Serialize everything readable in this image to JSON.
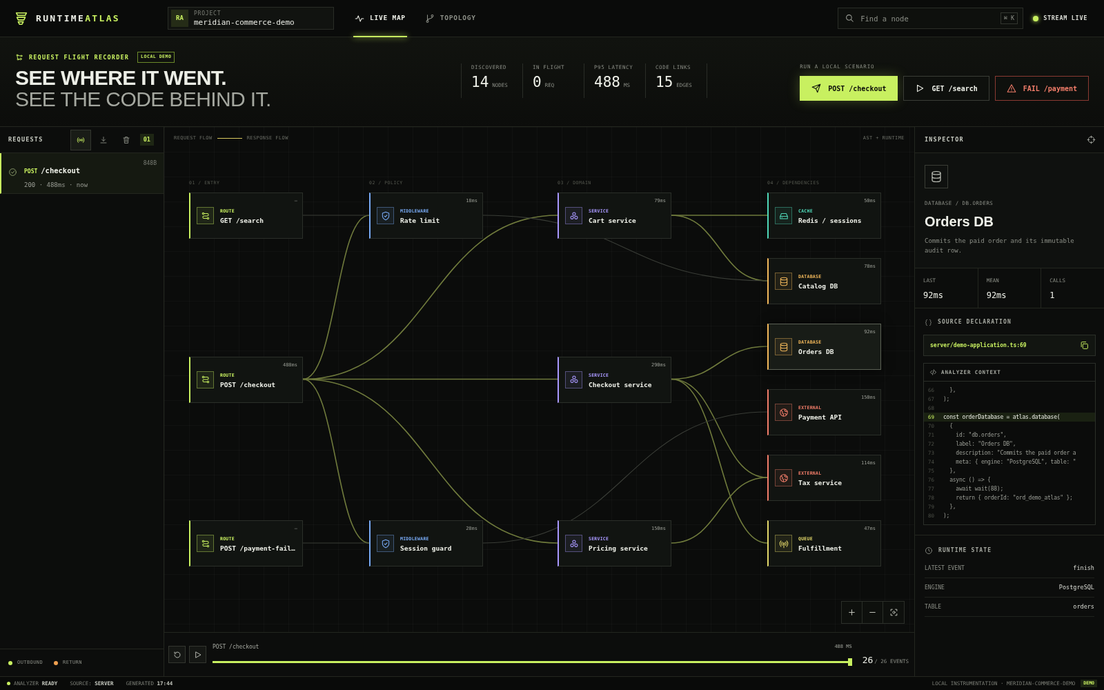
{
  "brand": {
    "name_part": "RUNTIME",
    "accent_part": "ATLAS"
  },
  "project": {
    "avatar": "RA",
    "label": "PROJECT",
    "name": "meridian-commerce-demo"
  },
  "tabs": [
    {
      "label": "LIVE MAP",
      "selected": true
    },
    {
      "label": "TOPOLOGY",
      "selected": false
    }
  ],
  "search": {
    "placeholder": "Find a node",
    "shortcut": "⌘ K"
  },
  "stream": {
    "label": "STREAM LIVE",
    "on": true
  },
  "hero": {
    "eyebrow": "REQUEST FLIGHT RECORDER",
    "badge": "LOCAL DEMO",
    "headline": "SEE WHERE IT WENT.",
    "subheadline": "SEE THE CODE BEHIND IT."
  },
  "stats": [
    {
      "label": "DISCOVERED",
      "value": "14",
      "unit": "NODES"
    },
    {
      "label": "IN FLIGHT",
      "value": "0",
      "unit": "REQ"
    },
    {
      "label": "P95 LATENCY",
      "value": "488",
      "unit": "MS"
    },
    {
      "label": "CODE LINKS",
      "value": "15",
      "unit": "EDGES"
    }
  ],
  "scenarios": {
    "label": "RUN A LOCAL SCENARIO",
    "buttons": [
      {
        "kind": "primary",
        "label": "POST /checkout"
      },
      {
        "kind": "default",
        "label": "GET /search"
      },
      {
        "kind": "danger",
        "label": "FAIL /payment"
      }
    ]
  },
  "requests": {
    "title": "REQUESTS",
    "count": "01",
    "tools": [
      {
        "selected": true
      },
      {
        "selected": false
      },
      {
        "selected": false
      }
    ],
    "items": [
      {
        "method": "POST",
        "path": "/checkout",
        "meta": "200 · 488ms · now",
        "size": "848B",
        "selected": true
      }
    ]
  },
  "legend": [
    {
      "label": "OUTBOUND",
      "color": "#c8f060"
    },
    {
      "label": "RETURN",
      "color": "#f0a050"
    }
  ],
  "canvas": {
    "flow_legend": [
      "REQUEST FLOW",
      "RESPONSE FLOW"
    ],
    "mode": "AST + RUNTIME",
    "columns": [
      {
        "label": "01 / ENTRY",
        "nodes": [
          {
            "kind": "route",
            "type_label": "ROUTE",
            "name": "GET /search",
            "duration": "—",
            "selected": false
          },
          {
            "kind": "route",
            "type_label": "ROUTE",
            "name": "POST /checkout",
            "duration": "488ms",
            "selected": false
          },
          {
            "kind": "route",
            "type_label": "ROUTE",
            "name": "POST /payment-fail…",
            "duration": "—",
            "selected": false
          }
        ]
      },
      {
        "label": "02 / POLICY",
        "nodes": [
          {
            "kind": "middleware",
            "type_label": "MIDDLEWARE",
            "name": "Rate limit",
            "duration": "18ms",
            "selected": false
          },
          {
            "kind": "middleware",
            "type_label": "MIDDLEWARE",
            "name": "Session guard",
            "duration": "28ms",
            "selected": false
          }
        ]
      },
      {
        "label": "03 / DOMAIN",
        "nodes": [
          {
            "kind": "service",
            "type_label": "SERVICE",
            "name": "Cart service",
            "duration": "79ms",
            "selected": false
          },
          {
            "kind": "service",
            "type_label": "SERVICE",
            "name": "Checkout service",
            "duration": "290ms",
            "selected": false
          },
          {
            "kind": "service",
            "type_label": "SERVICE",
            "name": "Pricing service",
            "duration": "150ms",
            "selected": false
          }
        ]
      },
      {
        "label": "04 / DEPENDENCIES",
        "nodes": [
          {
            "kind": "cache",
            "type_label": "CACHE",
            "name": "Redis / sessions",
            "duration": "50ms",
            "selected": false
          },
          {
            "kind": "database",
            "type_label": "DATABASE",
            "name": "Catalog DB",
            "duration": "78ms",
            "selected": false
          },
          {
            "kind": "database",
            "type_label": "DATABASE",
            "name": "Orders DB",
            "duration": "92ms",
            "selected": true
          },
          {
            "kind": "external",
            "type_label": "EXTERNAL",
            "name": "Payment API",
            "duration": "150ms",
            "selected": false
          },
          {
            "kind": "external",
            "type_label": "EXTERNAL",
            "name": "Tax service",
            "duration": "114ms",
            "selected": false
          },
          {
            "kind": "queue",
            "type_label": "QUEUE",
            "name": "Fulfillment",
            "duration": "47ms",
            "selected": false
          }
        ]
      }
    ]
  },
  "timeline": {
    "request": "POST /checkout",
    "duration": "488 MS",
    "level": 1,
    "current": "26",
    "total": "/ 26 EVENTS"
  },
  "inspector": {
    "title": "INSPECTOR",
    "breadcrumb": "DATABASE / DB.ORDERS",
    "name": "Orders DB",
    "description": "Commits the paid order and its immutable audit row.",
    "metrics": [
      {
        "label": "LAST",
        "value": "92ms"
      },
      {
        "label": "MEAN",
        "value": "92ms"
      },
      {
        "label": "CALLS",
        "value": "1"
      }
    ],
    "source": {
      "title": "SOURCE DECLARATION",
      "path": "server/demo-application.ts:69"
    },
    "context": {
      "title": "ANALYZER CONTEXT",
      "lines": [
        {
          "number": "66",
          "code": "  },",
          "highlighted": false
        },
        {
          "number": "67",
          "code": ");",
          "highlighted": false
        },
        {
          "number": "68",
          "highlighted": false
        },
        {
          "number": "69",
          "code": "const orderDatabase = atlas.database(",
          "highlighted": true
        },
        {
          "number": "70",
          "code": "  {",
          "highlighted": false
        },
        {
          "number": "71",
          "code": "    id: \"db.orders\",",
          "highlighted": false
        },
        {
          "number": "72",
          "code": "    label: \"Orders DB\",",
          "highlighted": false
        },
        {
          "number": "73",
          "code": "    description: \"Commits the paid order a",
          "highlighted": false
        },
        {
          "number": "74",
          "code": "    meta: { engine: \"PostgreSQL\", table: \"",
          "highlighted": false
        },
        {
          "number": "75",
          "code": "  },",
          "highlighted": false
        },
        {
          "number": "76",
          "code": "  async () => {",
          "highlighted": false
        },
        {
          "number": "77",
          "code": "    await wait(88);",
          "highlighted": false
        },
        {
          "number": "78",
          "code": "    return { orderId: \"ord_demo_atlas\" };",
          "highlighted": false
        },
        {
          "number": "79",
          "code": "  },",
          "highlighted": false
        },
        {
          "number": "80",
          "code": ");",
          "highlighted": false
        }
      ]
    },
    "runtime": {
      "title": "RUNTIME STATE",
      "rows": [
        {
          "label": "LATEST EVENT",
          "value": "finish"
        },
        {
          "label": "ENGINE",
          "value": "PostgreSQL"
        },
        {
          "label": "TABLE",
          "value": "orders"
        }
      ]
    }
  },
  "status_bar": {
    "items": [
      "ANALYZER **READY**",
      "SOURCE: **SERVER**",
      "GENERATED **17:44**"
    ],
    "right": "LOCAL INSTRUMENTATION · MERIDIAN-COMMERCE-DEMO",
    "badge": "DEMO"
  }
}
